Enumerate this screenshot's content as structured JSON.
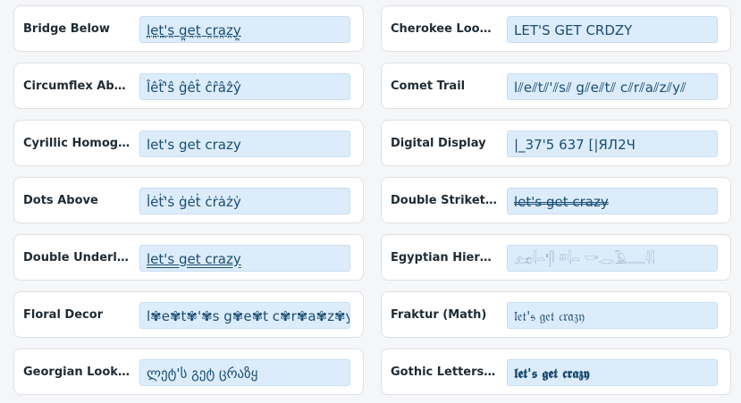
{
  "cards": [
    {
      "label": "Bridge Below",
      "preview": "l̪e̪t̪'̪s̪ g̪e̪t̪ c̪r̪a̪z̪y̪"
    },
    {
      "label": "Cherokee Looka...",
      "preview": "LET'S GET CRDZY"
    },
    {
      "label": "Circumflex Above",
      "preview": "l̂êt̂'̂ŝ ĝêt̂ ĉr̂âẑŷ"
    },
    {
      "label": "Comet Trail",
      "preview": "l⫽e⫽t⫽'⫽s⫽ g⫽e⫽t⫽ c⫽r⫽a⫽z⫽y⫽"
    },
    {
      "label": "Cyrillic Homogly...",
      "preview": "let's get crazy"
    },
    {
      "label": "Digital Display",
      "preview": "|_37'5 637 [|ЯЛ2Ч"
    },
    {
      "label": "Dots Above",
      "preview": "l̇ėṫ'̇ṡ ġėṫ ċṙȧżẏ"
    },
    {
      "label": "Double Strikethr...",
      "preview": "let's get crazy"
    },
    {
      "label": "Double Underline",
      "preview": "let's get crazy"
    },
    {
      "label": "Egyptian Hierog...",
      "preview": "𓃭𓇋𓏏'𓋴 𓎼𓇋𓏏 𓎡𓂋𓄿𓊃𓇌"
    },
    {
      "label": "Floral Decor",
      "preview": "l✾e✾t✾'✾s g✾e✾t c✾r✾a✾z✾y"
    },
    {
      "label": "Fraktur (Math)",
      "preview": "𝔩𝔢𝔱'𝔰 𝔤𝔢𝔱 𝔠𝔯𝔞𝔷𝔶"
    },
    {
      "label": "Georgian Lookal...",
      "preview": "ლეტ'ს გეტ ცრაზყ"
    },
    {
      "label": "Gothic Letters (...",
      "preview": "𝖑𝖊𝖙'𝖘 𝖌𝖊𝖙 𝖈𝖗𝖆𝖟𝖞"
    }
  ]
}
